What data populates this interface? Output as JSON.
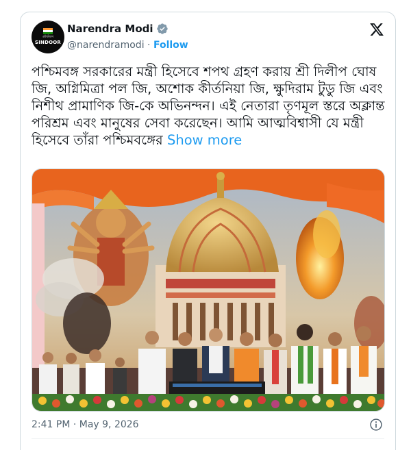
{
  "author": {
    "name": "Narendra Modi",
    "handle": "@narendramodi",
    "separator": "·",
    "follow_label": "Follow",
    "avatar_text": "SINDOOR",
    "avatar_small_text": "ऑपरेशन"
  },
  "tweet": {
    "text": "পশ্চিমবঙ্গ সরকারের মন্ত্রী হিসেবে শপথ গ্রহণ করায় শ্রী দিলীপ ঘোষ জি, অগ্নিমিত্রা পল জি, অশোক কীর্তনিয়া জি, ক্ষুদিরাম টুডু জি এবং নিশীথ প্রামাণিক জি-কে অভিনন্দন। এই নেতারা তৃণমূল স্তরে অক্লান্ত পরিশ্রম এবং মানুষের সেবা করেছেন। আমি আত্মবিশ্বাসী যে মন্ত্রী হিসেবে তাঁরা পশ্চিমবঙ্গের",
    "show_more": "Show more",
    "timestamp": "2:41 PM · May 9, 2026"
  },
  "colors": {
    "link": "#1d9bf0",
    "secondary_text": "#536471",
    "border": "#cfd9de",
    "verified_grey": "#829aab"
  },
  "icons": {
    "verified": "verified-badge-icon",
    "platform": "x-logo-icon",
    "info": "info-icon"
  }
}
